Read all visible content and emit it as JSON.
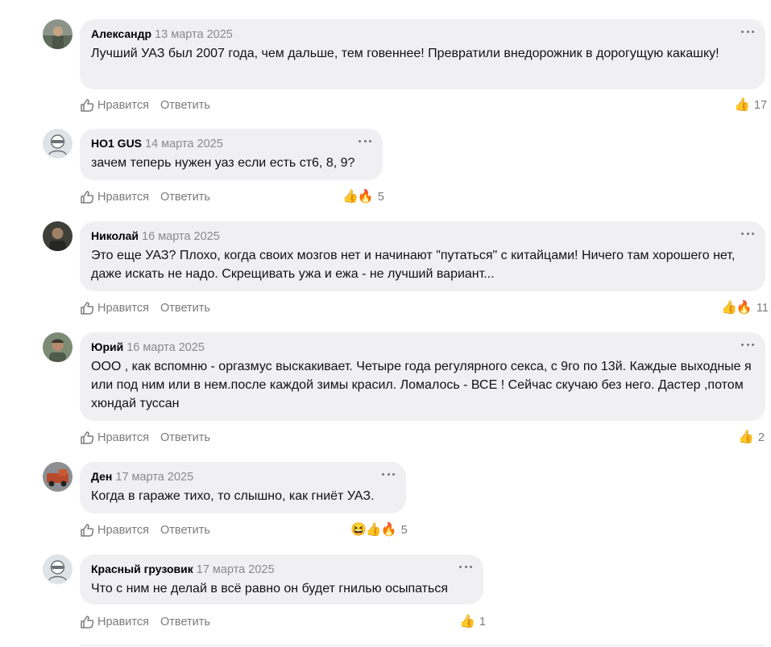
{
  "comments": [
    {
      "author": "Александр",
      "date": "13 марта 2025",
      "text": "Лучший УАЗ был 2007 года, чем дальше, тем говеннее! Превратили внедорожник в дорогущую какашку!",
      "like_label": "Нравится",
      "reply_label": "Ответить",
      "reactions": [
        "thumbs-up"
      ],
      "count": "17",
      "avatar_color": "#6f7a6d"
    },
    {
      "author": "НО1 GUS",
      "date": "14 марта 2025",
      "text": "зачем теперь нужен уаз если есть ст6, 8, 9?",
      "like_label": "Нравится",
      "reply_label": "Ответить",
      "reactions": [
        "thumbs-up",
        "fire"
      ],
      "count": "5",
      "avatar_color": "#dde3e6"
    },
    {
      "author": "Николай",
      "date": "16 марта 2025",
      "text": "Это еще УАЗ? Плохо, когда своих мозгов нет и начинают \"путаться\" с китайцами! Ничего там хорошего нет, даже искать не надо. Скрещивать ужа и ежа - не лучший вариант...",
      "like_label": "Нравится",
      "reply_label": "Ответить",
      "reactions": [
        "thumbs-up",
        "fire"
      ],
      "count": "11",
      "avatar_color": "#4b4d45"
    },
    {
      "author": "Юрий",
      "date": "16 марта 2025",
      "text": "ООО , как вспомню - оргазмус выскакивает. Четыре года регулярного секса, с 9го по 13й. Каждые выходные я или под ним или в нем.после каждой зимы красил. Ломалось - ВСЕ ! Сейчас скучаю без него. Дастер ,потом хюндай туссан",
      "like_label": "Нравится",
      "reply_label": "Ответить",
      "reactions": [
        "thumbs-up"
      ],
      "count": "2",
      "avatar_color": "#6a7864"
    },
    {
      "author": "Ден",
      "date": "17 марта 2025",
      "text": "Когда в гараже тихо, то слышно, как гниёт УАЗ.",
      "like_label": "Нравится",
      "reply_label": "Ответить",
      "reactions": [
        "laughing",
        "thumbs-up",
        "fire"
      ],
      "count": "5",
      "avatar_color": "#a8442c"
    },
    {
      "author": "Красный грузовик",
      "date": "17 марта 2025",
      "text": "Что с ним не делай в всё равно он будет гнилью осыпаться",
      "like_label": "Нравится",
      "reply_label": "Ответить",
      "reactions": [
        "thumbs-up"
      ],
      "count": "1",
      "avatar_color": "#dde3e6"
    }
  ]
}
